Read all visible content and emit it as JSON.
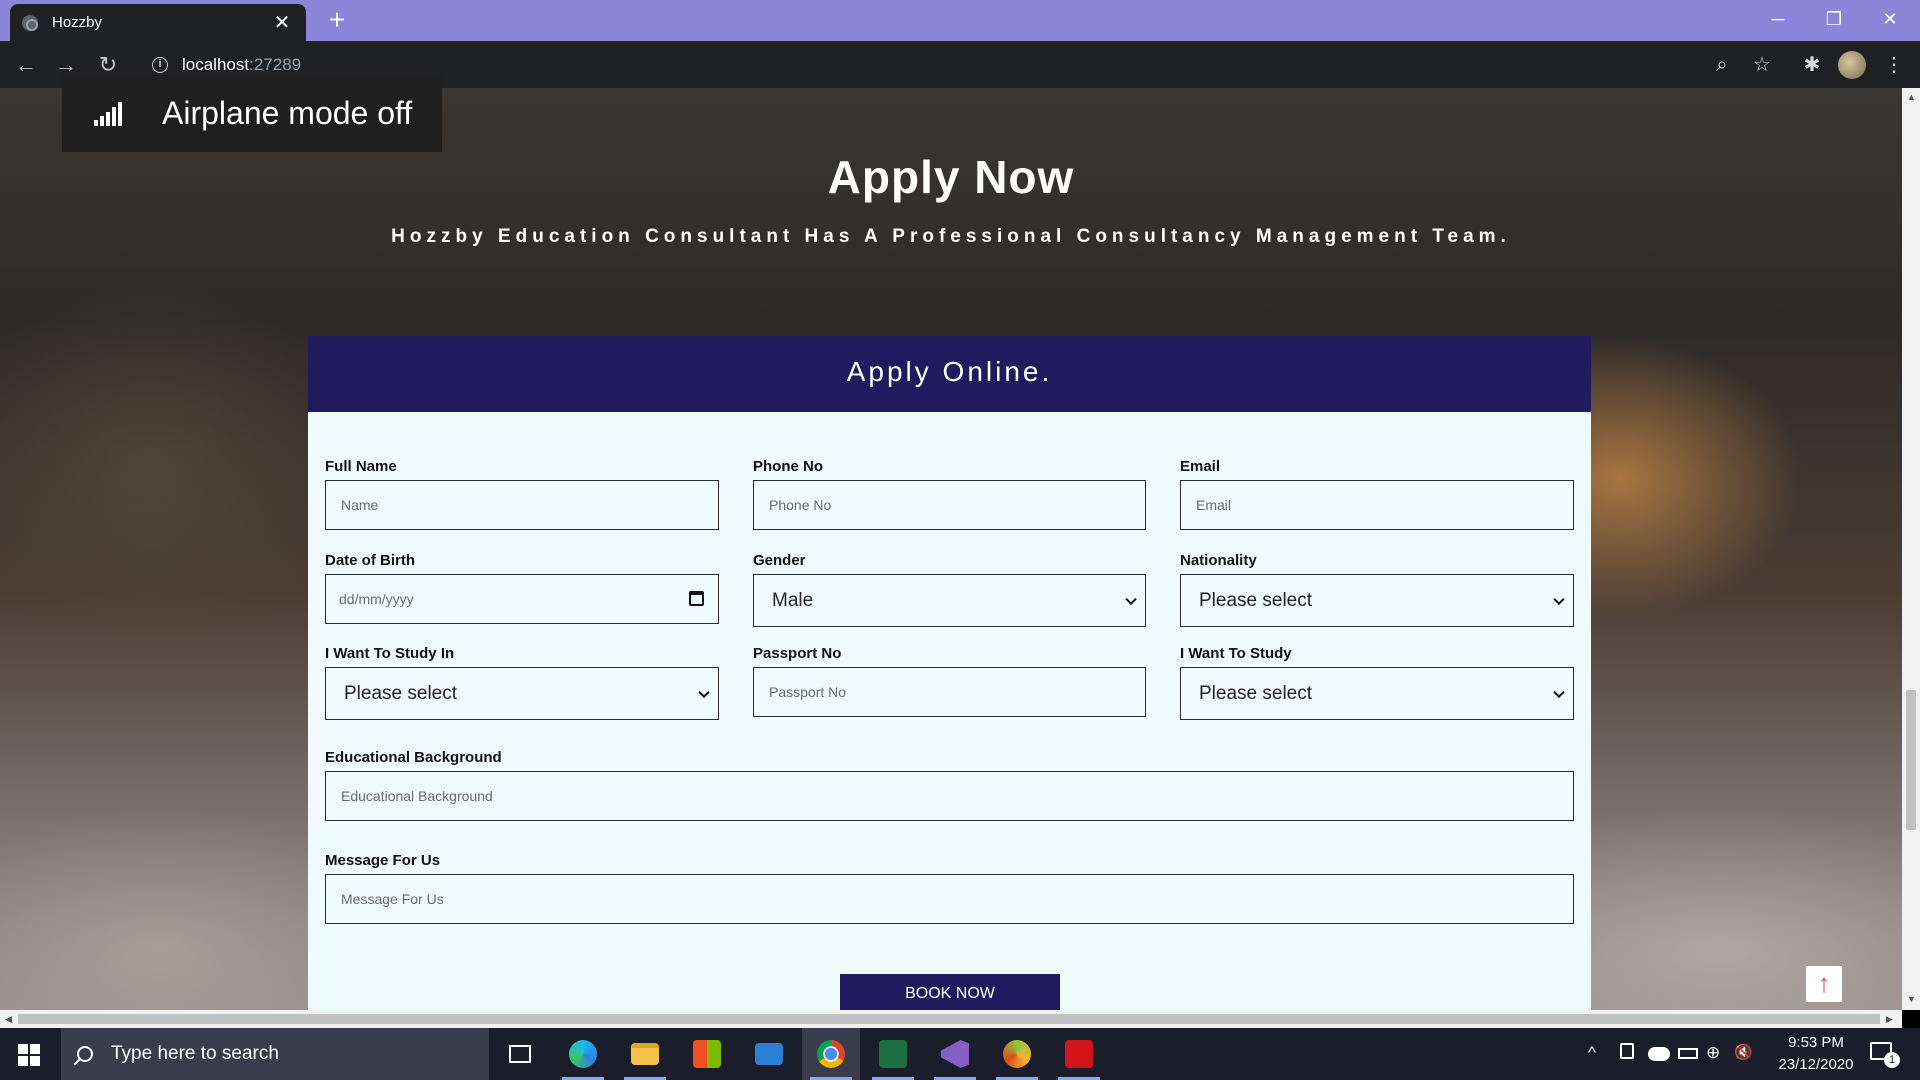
{
  "browser": {
    "tab_title": "Hozzby",
    "tab_close": "✕",
    "new_tab": "+",
    "url_host": "localhost",
    "url_port": ":27289",
    "window_controls": {
      "minimize": "─",
      "restore": "❐",
      "close": "✕"
    },
    "nav": {
      "back": "←",
      "forward": "→",
      "reload": "↻"
    },
    "toolbar_icons": {
      "zoom": "⌕",
      "bookmark": "☆",
      "extensions": "✱",
      "menu": "⋮"
    }
  },
  "toast": {
    "text": "Airplane mode off"
  },
  "hero": {
    "title": "Apply Now",
    "subtitle": "Hozzby Education Consultant Has A Professional Consultancy Management Team."
  },
  "form": {
    "header": "Apply Online.",
    "full_name": {
      "label": "Full Name",
      "placeholder": "Name"
    },
    "phone": {
      "label": "Phone No",
      "placeholder": "Phone No"
    },
    "email": {
      "label": "Email",
      "placeholder": "Email"
    },
    "dob": {
      "label": "Date of Birth",
      "placeholder": "dd/mm/yyyy"
    },
    "gender": {
      "label": "Gender",
      "value": "Male"
    },
    "nationality": {
      "label": "Nationality",
      "value": "Please select"
    },
    "study_in": {
      "label": "I Want To Study In",
      "value": "Please select"
    },
    "passport": {
      "label": "Passport No",
      "placeholder": "Passport No"
    },
    "study": {
      "label": "I Want To Study",
      "value": "Please select"
    },
    "education": {
      "label": "Educational Background",
      "placeholder": "Educational Background"
    },
    "message": {
      "label": "Message For Us",
      "placeholder": "Message For Us"
    },
    "submit": "BOOK NOW"
  },
  "scroll_top": "↑",
  "taskbar": {
    "search_placeholder": "Type here to search",
    "time": "9:53 PM",
    "date": "23/12/2020",
    "notification_count": "1",
    "apps": [
      "task-view",
      "edge",
      "file-explorer",
      "store",
      "mail",
      "chrome",
      "excel",
      "visual-studio",
      "app-swirl",
      "acrobat"
    ],
    "tray": {
      "chevron": "^",
      "network": "⊕",
      "volume": "🔇"
    }
  }
}
